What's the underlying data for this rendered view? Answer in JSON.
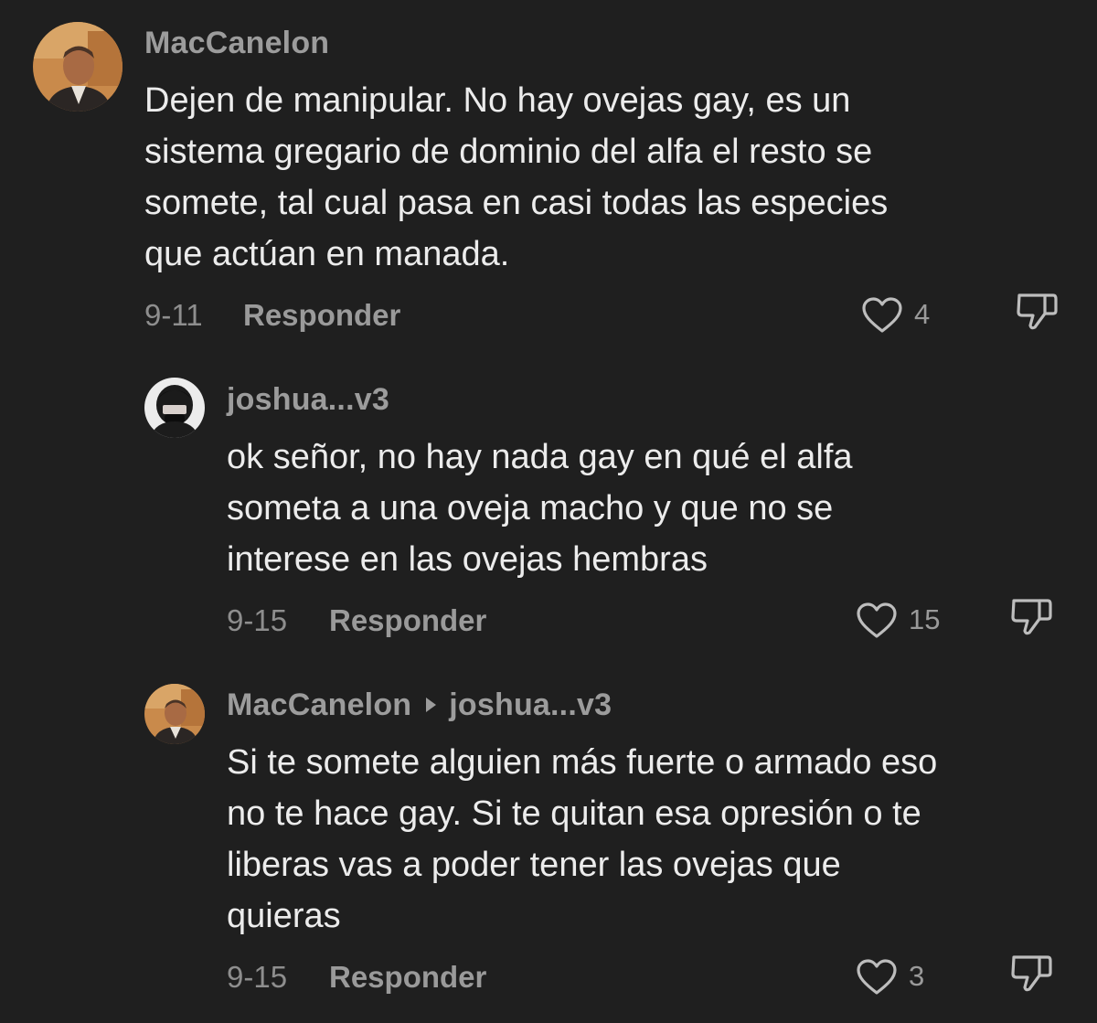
{
  "comments": [
    {
      "username": "MacCanelon",
      "lines": [
        "Dejen de manipular. No hay ovejas gay, es un",
        "sistema gregario de dominio del alfa el resto se",
        "somete, tal cual pasa en casi todas las especies",
        "que actúan en manada."
      ],
      "date": "9-11",
      "reply_label": "Responder",
      "likes": "4"
    },
    {
      "username": "joshua...v3",
      "lines": [
        "ok señor, no hay nada gay en qué el alfa",
        "someta a una oveja macho y que no se",
        "interese en las ovejas hembras"
      ],
      "date": "9-15",
      "reply_label": "Responder",
      "likes": "15"
    },
    {
      "username": "MacCanelon",
      "reply_to": "joshua...v3",
      "lines": [
        "Si te somete alguien más fuerte o armado eso",
        "no te hace gay. Si te quitan esa opresión o te",
        "liberas vas a poder tener las ovejas que",
        "quieras"
      ],
      "date": "9-15",
      "reply_label": "Responder",
      "likes": "3"
    }
  ],
  "icons": {
    "like": "heart-outline-icon",
    "dislike": "thumbs-down-outline-icon"
  },
  "colors": {
    "background": "#1f1f1f",
    "text": "#ececec",
    "muted": "#9a9a9a"
  }
}
